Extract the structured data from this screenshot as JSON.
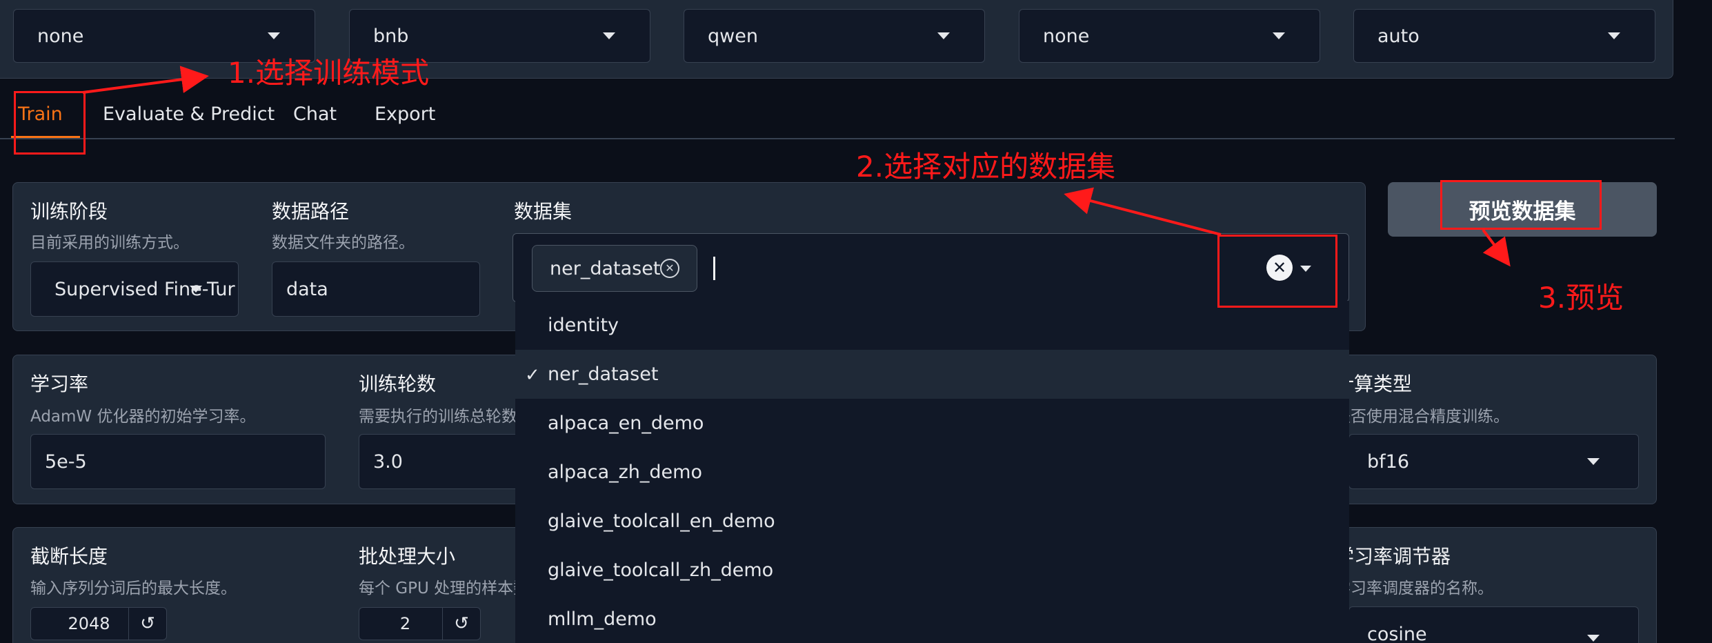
{
  "top_dropdowns": [
    {
      "value": "none"
    },
    {
      "value": "bnb"
    },
    {
      "value": "qwen"
    },
    {
      "value": "none"
    },
    {
      "value": "auto"
    }
  ],
  "tabs": [
    {
      "label": "Train"
    },
    {
      "label": "Evaluate & Predict"
    },
    {
      "label": "Chat"
    },
    {
      "label": "Export"
    }
  ],
  "stage": {
    "label": "训练阶段",
    "info": "目前采用的训练方式。",
    "value": "Supervised Fine-Tur"
  },
  "dataset_dir": {
    "label": "数据路径",
    "info": "数据文件夹的路径。",
    "value": "data"
  },
  "dataset": {
    "label": "数据集",
    "chip": "ner_dataset",
    "clear_icon": "✕",
    "chip_remove_icon": "✕"
  },
  "dataset_options": [
    {
      "label": "identity",
      "selected": false
    },
    {
      "label": "ner_dataset",
      "selected": true
    },
    {
      "label": "alpaca_en_demo",
      "selected": false
    },
    {
      "label": "alpaca_zh_demo",
      "selected": false
    },
    {
      "label": "glaive_toolcall_en_demo",
      "selected": false
    },
    {
      "label": "glaive_toolcall_zh_demo",
      "selected": false
    },
    {
      "label": "mllm_demo",
      "selected": false
    }
  ],
  "check_mark": "✓",
  "preview_button": "预览数据集",
  "learning_rate": {
    "label": "学习率",
    "info": "AdamW 优化器的初始学习率。",
    "value": "5e-5"
  },
  "epochs": {
    "label": "训练轮数",
    "info": "需要执行的训练总轮数",
    "value": "3.0"
  },
  "compute_type": {
    "label": "计算类型",
    "info": "是否使用混合精度训练。",
    "value": "bf16"
  },
  "cutoff_len": {
    "label": "截断长度",
    "info": "输入序列分词后的最大长度。",
    "value": "2048"
  },
  "batch_size": {
    "label": "批处理大小",
    "info": "每个 GPU 处理的样本数",
    "value": "2"
  },
  "lr_scheduler": {
    "label": "学习率调节器",
    "info": "学习率调度器的名称。",
    "value": "cosine"
  },
  "reset_icon": "↺",
  "annotations": {
    "step1": "1.选择训练模式",
    "step2": "2.选择对应的数据集",
    "step3": "3.预览"
  },
  "colors": {
    "accent": "#f97316",
    "annotation": "#ff1a1a"
  }
}
